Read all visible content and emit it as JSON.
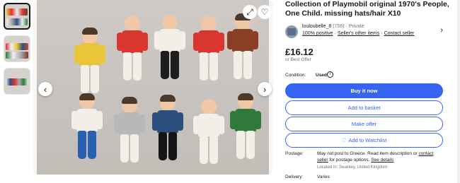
{
  "listing": {
    "title": "Collection of Playmobil original 1970's People, One Child. missing hats/hair X10"
  },
  "seller": {
    "name": "louloubelle_8",
    "feedback": "(756)",
    "type": "Private",
    "positive": "100% positive",
    "other_items": "Seller's other items",
    "contact": "Contact seller"
  },
  "price": {
    "amount": "£16.12",
    "best_offer": "or Best Offer"
  },
  "condition": {
    "label": "Condition:",
    "value": "Used"
  },
  "buttons": {
    "buy_now": "Buy it now",
    "add_basket": "Add to basket",
    "make_offer": "Make offer",
    "watchlist": "Add to Watchlist"
  },
  "postage": {
    "label": "Postage:",
    "text_part1": "May not post to Greece. Read item description or ",
    "contact_link": "contact seller",
    "text_part2": " for postage options. ",
    "details_link": "See details",
    "located": "Located in: Swanley, United Kingdom"
  },
  "delivery": {
    "label": "Delivery:",
    "value": "Varies"
  },
  "icons": {
    "prev": "chevron-left-icon",
    "next": "chevron-right-icon",
    "expand": "expand-icon",
    "heart": "heart-icon",
    "seller_chevron": "chevron-right-icon",
    "watch_heart": "heart-outline-icon",
    "info": "info-icon"
  },
  "colors": {
    "accent": "#3665f3",
    "text": "#191919",
    "muted": "#707070"
  }
}
